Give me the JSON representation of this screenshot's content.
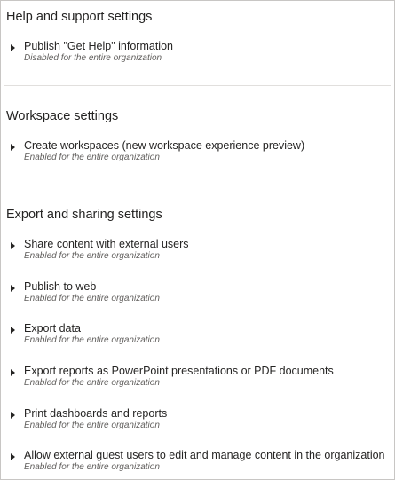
{
  "sections": [
    {
      "title": "Help and support settings",
      "items": [
        {
          "label": "Publish \"Get Help\" information",
          "status": "Disabled for the entire organization"
        }
      ]
    },
    {
      "title": "Workspace settings",
      "items": [
        {
          "label": "Create workspaces (new workspace experience preview)",
          "status": "Enabled for the entire organization"
        }
      ]
    },
    {
      "title": "Export and sharing settings",
      "items": [
        {
          "label": "Share content with external users",
          "status": "Enabled for the entire organization"
        },
        {
          "label": "Publish to web",
          "status": "Enabled for the entire organization"
        },
        {
          "label": "Export data",
          "status": "Enabled for the entire organization"
        },
        {
          "label": "Export reports as PowerPoint presentations or PDF documents",
          "status": "Enabled for the entire organization"
        },
        {
          "label": "Print dashboards and reports",
          "status": "Enabled for the entire organization"
        },
        {
          "label": "Allow external guest users to edit and manage content in the organization",
          "status": "Enabled for the entire organization"
        }
      ]
    }
  ]
}
